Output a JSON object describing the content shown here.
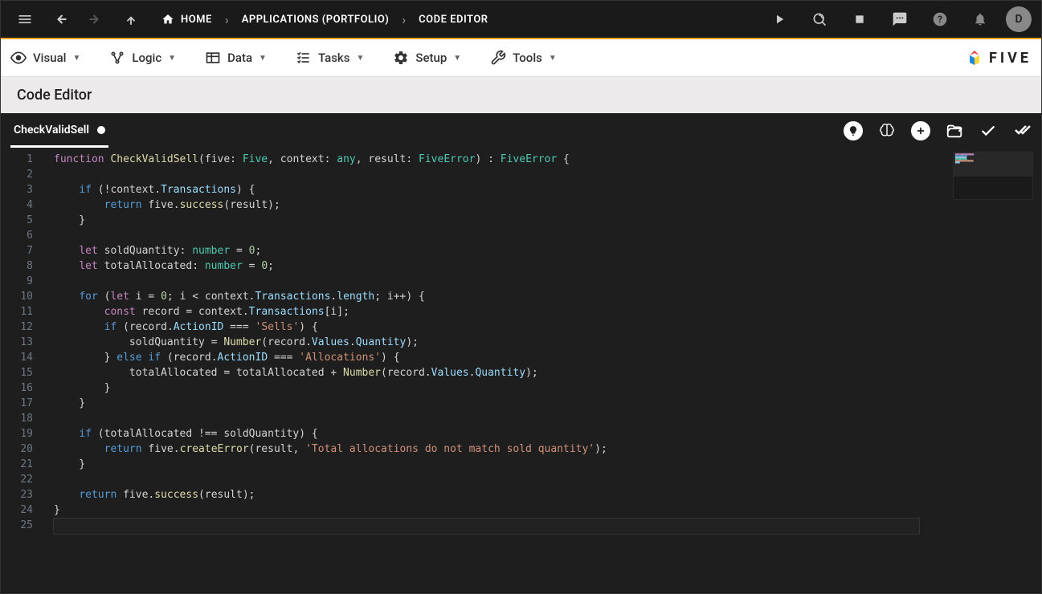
{
  "breadcrumb": {
    "home": "HOME",
    "applications": "APPLICATIONS (PORTFOLIO)",
    "editor": "CODE EDITOR"
  },
  "avatar_letter": "D",
  "menu": {
    "visual": "Visual",
    "logic": "Logic",
    "data": "Data",
    "tasks": "Tasks",
    "setup": "Setup",
    "tools": "Tools"
  },
  "logo_text": "FIVE",
  "page_title": "Code Editor",
  "tab_name": "CheckValidSell",
  "code": {
    "lines": [
      {
        "n": 1,
        "t": [
          [
            "keyword",
            "function"
          ],
          [
            "punct",
            " "
          ],
          [
            "func",
            "CheckValidSell"
          ],
          [
            "punct",
            "("
          ],
          [
            "ident",
            "five"
          ],
          [
            "punct",
            ": "
          ],
          [
            "type",
            "Five"
          ],
          [
            "punct",
            ", "
          ],
          [
            "ident",
            "context"
          ],
          [
            "punct",
            ": "
          ],
          [
            "type",
            "any"
          ],
          [
            "punct",
            ", "
          ],
          [
            "ident",
            "result"
          ],
          [
            "punct",
            ": "
          ],
          [
            "type",
            "FiveError"
          ],
          [
            "punct",
            ") : "
          ],
          [
            "type",
            "FiveError"
          ],
          [
            "punct",
            " {"
          ]
        ]
      },
      {
        "n": 2,
        "t": []
      },
      {
        "n": 3,
        "t": [
          [
            "punct",
            "    "
          ],
          [
            "control",
            "if"
          ],
          [
            "punct",
            " (!"
          ],
          [
            "ident",
            "context"
          ],
          [
            "punct",
            "."
          ],
          [
            "property",
            "Transactions"
          ],
          [
            "punct",
            ") {"
          ]
        ]
      },
      {
        "n": 4,
        "t": [
          [
            "punct",
            "        "
          ],
          [
            "control",
            "return"
          ],
          [
            "punct",
            " "
          ],
          [
            "ident",
            "five"
          ],
          [
            "punct",
            "."
          ],
          [
            "func",
            "success"
          ],
          [
            "punct",
            "("
          ],
          [
            "ident",
            "result"
          ],
          [
            "punct",
            ");"
          ]
        ]
      },
      {
        "n": 5,
        "t": [
          [
            "punct",
            "    }"
          ]
        ]
      },
      {
        "n": 6,
        "t": []
      },
      {
        "n": 7,
        "t": [
          [
            "punct",
            "    "
          ],
          [
            "keyword",
            "let"
          ],
          [
            "punct",
            " "
          ],
          [
            "ident",
            "soldQuantity"
          ],
          [
            "punct",
            ": "
          ],
          [
            "type",
            "number"
          ],
          [
            "punct",
            " = "
          ],
          [
            "number",
            "0"
          ],
          [
            "punct",
            ";"
          ]
        ]
      },
      {
        "n": 8,
        "t": [
          [
            "punct",
            "    "
          ],
          [
            "keyword",
            "let"
          ],
          [
            "punct",
            " "
          ],
          [
            "ident",
            "totalAllocated"
          ],
          [
            "punct",
            ": "
          ],
          [
            "type",
            "number"
          ],
          [
            "punct",
            " = "
          ],
          [
            "number",
            "0"
          ],
          [
            "punct",
            ";"
          ]
        ]
      },
      {
        "n": 9,
        "t": []
      },
      {
        "n": 10,
        "t": [
          [
            "punct",
            "    "
          ],
          [
            "control",
            "for"
          ],
          [
            "punct",
            " ("
          ],
          [
            "keyword",
            "let"
          ],
          [
            "punct",
            " "
          ],
          [
            "ident",
            "i"
          ],
          [
            "punct",
            " = "
          ],
          [
            "number",
            "0"
          ],
          [
            "punct",
            "; "
          ],
          [
            "ident",
            "i"
          ],
          [
            "punct",
            " < "
          ],
          [
            "ident",
            "context"
          ],
          [
            "punct",
            "."
          ],
          [
            "property",
            "Transactions"
          ],
          [
            "punct",
            "."
          ],
          [
            "property",
            "length"
          ],
          [
            "punct",
            "; "
          ],
          [
            "ident",
            "i"
          ],
          [
            "punct",
            "++) {"
          ]
        ]
      },
      {
        "n": 11,
        "t": [
          [
            "punct",
            "        "
          ],
          [
            "keyword",
            "const"
          ],
          [
            "punct",
            " "
          ],
          [
            "ident",
            "record"
          ],
          [
            "punct",
            " = "
          ],
          [
            "ident",
            "context"
          ],
          [
            "punct",
            "."
          ],
          [
            "property",
            "Transactions"
          ],
          [
            "punct",
            "["
          ],
          [
            "ident",
            "i"
          ],
          [
            "punct",
            "];"
          ]
        ]
      },
      {
        "n": 12,
        "t": [
          [
            "punct",
            "        "
          ],
          [
            "control",
            "if"
          ],
          [
            "punct",
            " ("
          ],
          [
            "ident",
            "record"
          ],
          [
            "punct",
            "."
          ],
          [
            "property",
            "ActionID"
          ],
          [
            "punct",
            " === "
          ],
          [
            "string",
            "'Sells'"
          ],
          [
            "punct",
            ") {"
          ]
        ]
      },
      {
        "n": 13,
        "t": [
          [
            "punct",
            "            "
          ],
          [
            "ident",
            "soldQuantity"
          ],
          [
            "punct",
            " = "
          ],
          [
            "func",
            "Number"
          ],
          [
            "punct",
            "("
          ],
          [
            "ident",
            "record"
          ],
          [
            "punct",
            "."
          ],
          [
            "property",
            "Values"
          ],
          [
            "punct",
            "."
          ],
          [
            "property",
            "Quantity"
          ],
          [
            "punct",
            ");"
          ]
        ]
      },
      {
        "n": 14,
        "t": [
          [
            "punct",
            "        } "
          ],
          [
            "control",
            "else"
          ],
          [
            "punct",
            " "
          ],
          [
            "control",
            "if"
          ],
          [
            "punct",
            " ("
          ],
          [
            "ident",
            "record"
          ],
          [
            "punct",
            "."
          ],
          [
            "property",
            "ActionID"
          ],
          [
            "punct",
            " === "
          ],
          [
            "string",
            "'Allocations'"
          ],
          [
            "punct",
            ") {"
          ]
        ]
      },
      {
        "n": 15,
        "t": [
          [
            "punct",
            "            "
          ],
          [
            "ident",
            "totalAllocated"
          ],
          [
            "punct",
            " = "
          ],
          [
            "ident",
            "totalAllocated"
          ],
          [
            "punct",
            " + "
          ],
          [
            "func",
            "Number"
          ],
          [
            "punct",
            "("
          ],
          [
            "ident",
            "record"
          ],
          [
            "punct",
            "."
          ],
          [
            "property",
            "Values"
          ],
          [
            "punct",
            "."
          ],
          [
            "property",
            "Quantity"
          ],
          [
            "punct",
            ");"
          ]
        ]
      },
      {
        "n": 16,
        "t": [
          [
            "punct",
            "        }"
          ]
        ]
      },
      {
        "n": 17,
        "t": [
          [
            "punct",
            "    }"
          ]
        ]
      },
      {
        "n": 18,
        "t": []
      },
      {
        "n": 19,
        "t": [
          [
            "punct",
            "    "
          ],
          [
            "control",
            "if"
          ],
          [
            "punct",
            " ("
          ],
          [
            "ident",
            "totalAllocated"
          ],
          [
            "punct",
            " !== "
          ],
          [
            "ident",
            "soldQuantity"
          ],
          [
            "punct",
            ") {"
          ]
        ]
      },
      {
        "n": 20,
        "t": [
          [
            "punct",
            "        "
          ],
          [
            "control",
            "return"
          ],
          [
            "punct",
            " "
          ],
          [
            "ident",
            "five"
          ],
          [
            "punct",
            "."
          ],
          [
            "func",
            "createError"
          ],
          [
            "punct",
            "("
          ],
          [
            "ident",
            "result"
          ],
          [
            "punct",
            ", "
          ],
          [
            "string",
            "'Total allocations do not match sold quantity'"
          ],
          [
            "punct",
            ");"
          ]
        ]
      },
      {
        "n": 21,
        "t": [
          [
            "punct",
            "    }"
          ]
        ]
      },
      {
        "n": 22,
        "t": []
      },
      {
        "n": 23,
        "t": [
          [
            "punct",
            "    "
          ],
          [
            "control",
            "return"
          ],
          [
            "punct",
            " "
          ],
          [
            "ident",
            "five"
          ],
          [
            "punct",
            "."
          ],
          [
            "func",
            "success"
          ],
          [
            "punct",
            "("
          ],
          [
            "ident",
            "result"
          ],
          [
            "punct",
            ");"
          ]
        ]
      },
      {
        "n": 24,
        "t": [
          [
            "punct",
            "}"
          ]
        ]
      },
      {
        "n": 25,
        "t": [],
        "current": true
      }
    ]
  }
}
